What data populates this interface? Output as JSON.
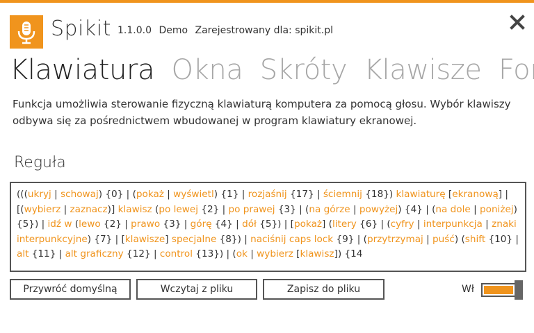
{
  "colors": {
    "accent": "#f0941d",
    "text": "#333333",
    "inactive_tab": "#a6a6a6"
  },
  "header": {
    "app_name": "Spikit",
    "version": "1.1.0.0",
    "edition": "Demo",
    "registration": "Zarejestrowany dla: spikit.pl",
    "logo_icon": "microphone-icon",
    "close_icon": "close-icon"
  },
  "tabs": [
    {
      "label": "Klawiatura",
      "active": true
    },
    {
      "label": "Okna",
      "active": false
    },
    {
      "label": "Skróty",
      "active": false
    },
    {
      "label": "Klawisze",
      "active": false
    },
    {
      "label": "Form",
      "active": false
    }
  ],
  "description": "Funkcja umożliwia sterowanie fizyczną klawiaturą komputera za pomocą głosu. Wybór klawiszy odbywa się za pośrednictwem wbudowanej w program klawiatury ekranowej.",
  "rule": {
    "title": "Reguła",
    "segments": [
      [
        "(((",
        0
      ],
      [
        "ukryj",
        1
      ],
      [
        " | ",
        0
      ],
      [
        "schowaj",
        1
      ],
      [
        ") {0} | (",
        0
      ],
      [
        "pokaż",
        1
      ],
      [
        " | ",
        0
      ],
      [
        "wyświetl",
        1
      ],
      [
        ") {1} | ",
        0
      ],
      [
        "rozjaśnij",
        1
      ],
      [
        " {17} | ",
        0
      ],
      [
        "ściemnij",
        1
      ],
      [
        " {18}) ",
        0
      ],
      [
        "klawiaturę",
        1
      ],
      [
        " [",
        0
      ],
      [
        "ekranową",
        1
      ],
      [
        "] | [(",
        0
      ],
      [
        "wybierz",
        1
      ],
      [
        " | ",
        0
      ],
      [
        "zaznacz",
        1
      ],
      [
        ")] ",
        0
      ],
      [
        "klawisz",
        1
      ],
      [
        " (",
        0
      ],
      [
        "po lewej",
        1
      ],
      [
        " {2} | ",
        0
      ],
      [
        "po prawej",
        1
      ],
      [
        " {3} | (",
        0
      ],
      [
        "na górze",
        1
      ],
      [
        " | ",
        0
      ],
      [
        "powyżej",
        1
      ],
      [
        ") {4} | (",
        0
      ],
      [
        "na dole",
        1
      ],
      [
        " | ",
        0
      ],
      [
        "poniżej",
        1
      ],
      [
        ") {5}) | ",
        0
      ],
      [
        "idź w",
        1
      ],
      [
        " (",
        0
      ],
      [
        "lewo",
        1
      ],
      [
        " {2} | ",
        0
      ],
      [
        "prawo",
        1
      ],
      [
        " {3} | ",
        0
      ],
      [
        "górę",
        1
      ],
      [
        " {4} | ",
        0
      ],
      [
        "dół",
        1
      ],
      [
        " {5}) | [",
        0
      ],
      [
        "pokaż",
        1
      ],
      [
        "] (",
        0
      ],
      [
        "litery",
        1
      ],
      [
        " {6} | (",
        0
      ],
      [
        "cyfry",
        1
      ],
      [
        " | ",
        0
      ],
      [
        "interpunkcja",
        1
      ],
      [
        " | ",
        0
      ],
      [
        "znaki interpunkcyjne",
        1
      ],
      [
        ") {7} | [",
        0
      ],
      [
        "klawisze",
        1
      ],
      [
        "] ",
        0
      ],
      [
        "specjalne",
        1
      ],
      [
        " {8}) | ",
        0
      ],
      [
        "naciśnij caps lock",
        1
      ],
      [
        " {9} | (",
        0
      ],
      [
        "przytrzymaj",
        1
      ],
      [
        " | ",
        0
      ],
      [
        "puść",
        1
      ],
      [
        ") (",
        0
      ],
      [
        "shift",
        1
      ],
      [
        " {10} | ",
        0
      ],
      [
        "alt",
        1
      ],
      [
        " {11} | ",
        0
      ],
      [
        "alt graficzny",
        1
      ],
      [
        " {12} | ",
        0
      ],
      [
        "control",
        1
      ],
      [
        " {13}) | (",
        0
      ],
      [
        "ok",
        1
      ],
      [
        " | ",
        0
      ],
      [
        "wybierz",
        1
      ],
      [
        " [",
        0
      ],
      [
        "klawisz",
        1
      ],
      [
        "]) {14",
        0
      ]
    ]
  },
  "buttons": {
    "restore": "Przywróć domyślną",
    "load": "Wczytaj z pliku",
    "save": "Zapisz do pliku"
  },
  "toggle": {
    "label": "Wł",
    "on": true
  }
}
